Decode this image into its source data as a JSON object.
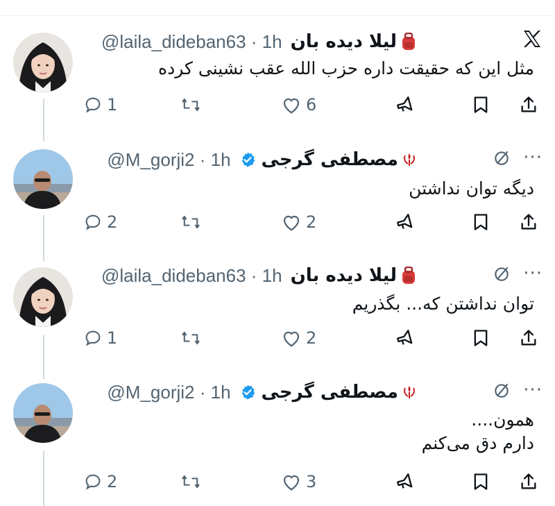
{
  "tweets": [
    {
      "name": "لیلا دیده بان",
      "name_emoji": "backpack",
      "handle": "@laila_dideban63",
      "time": "1h",
      "verified": false,
      "text_lines": [
        "مثل این که حقیقت داره حزب الله عقب نشینی کرده"
      ],
      "replies": "1",
      "retweets": "",
      "likes": "6",
      "corner": "x-logo"
    },
    {
      "name": "مصطفی گرجی",
      "name_emoji": "iran-emblem",
      "handle": "@M_gorji2",
      "time": "1h",
      "verified": true,
      "text_lines": [
        "دیگه توان نداشتن"
      ],
      "replies": "2",
      "retweets": "",
      "likes": "2",
      "corner": "more"
    },
    {
      "name": "لیلا دیده بان",
      "name_emoji": "backpack",
      "handle": "@laila_dideban63",
      "time": "1h",
      "verified": false,
      "text_lines": [
        "توان نداشتن که... بگذریم"
      ],
      "replies": "1",
      "retweets": "",
      "likes": "2",
      "corner": "more"
    },
    {
      "name": "مصطفی گرجی",
      "name_emoji": "iran-emblem",
      "handle": "@M_gorji2",
      "time": "1h",
      "verified": true,
      "text_lines": [
        "همون....",
        "دارم دق می‌کنم"
      ],
      "replies": "2",
      "retweets": "",
      "likes": "3",
      "corner": "more"
    }
  ],
  "colors": {
    "text": "#0f1419",
    "secondary": "#536471",
    "verified": "#1d9bf0",
    "thread_line": "#cfd9de"
  },
  "icons": [
    "reply-icon",
    "retweet-icon",
    "like-icon",
    "grok-icon",
    "bookmark-icon",
    "share-icon",
    "more-icon",
    "x-logo",
    "verified-icon"
  ]
}
